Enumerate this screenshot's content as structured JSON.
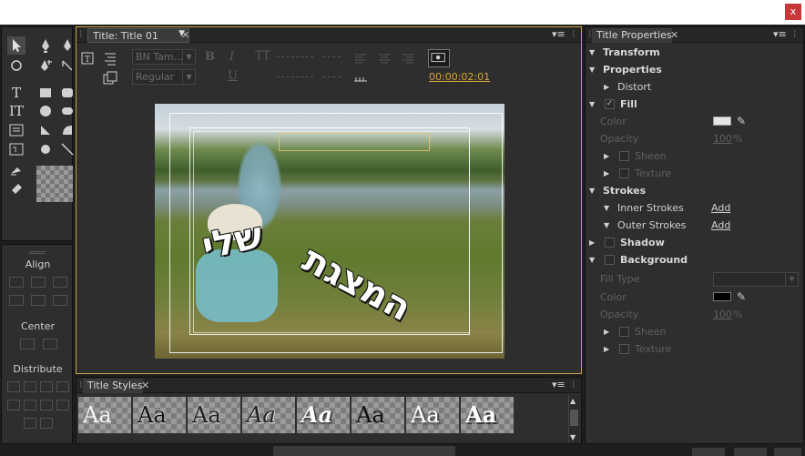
{
  "window": {
    "close_label": "x"
  },
  "tools": {
    "items": [
      "selection-tool",
      "pen-tool",
      "add-anchor-tool",
      "rotate-tool",
      "delete-anchor-tool",
      "convert-anchor-tool",
      "type-tool",
      "vertical-type-tool",
      "area-type-tool",
      "rectangle-tool",
      "rounded-rectangle-tool",
      "clipped-corner-tool",
      "ellipse-tool",
      "wedge-tool",
      "arc-tool",
      "line-tool"
    ]
  },
  "align_panel": {
    "align_label": "Align",
    "center_label": "Center",
    "distribute_label": "Distribute"
  },
  "title_panel": {
    "tab_label": "Title: Title 01",
    "font_family": "BN Tam...",
    "font_style": "Regular",
    "bold_btn": "B",
    "italic_btn": "I",
    "underline_btn": "U",
    "timecode": "00:00:02:01",
    "canvas_text_1": "שלי",
    "canvas_text_2": "המצגת"
  },
  "styles_panel": {
    "tab_label": "Title Styles",
    "samples": [
      "Aa",
      "Aa",
      "Aa",
      "Aa",
      "Aa",
      "Aa",
      "Aa",
      "Aa"
    ]
  },
  "properties": {
    "tab_label": "Title Properties",
    "transform": "Transform",
    "properties": "Properties",
    "distort": "Distort",
    "fill": "Fill",
    "color": "Color",
    "opacity": "Opacity",
    "opacity_value": "100",
    "percent": "%",
    "sheen": "Sheen",
    "texture": "Texture",
    "strokes": "Strokes",
    "inner_strokes": "Inner Strokes",
    "outer_strokes": "Outer Strokes",
    "add": "Add",
    "shadow": "Shadow",
    "background": "Background",
    "fill_type": "Fill Type",
    "bg_color": "Color",
    "bg_opacity": "Opacity",
    "bg_opacity_value": "100",
    "bg_percent": "%",
    "bg_sheen": "Sheen",
    "bg_texture": "Texture",
    "fill_color": "#e6e6e6",
    "bg_color_value": "#000000"
  },
  "colors": {
    "accent": "#c7a24b",
    "close_red": "#c8373a",
    "timecode": "#d7a53a"
  }
}
